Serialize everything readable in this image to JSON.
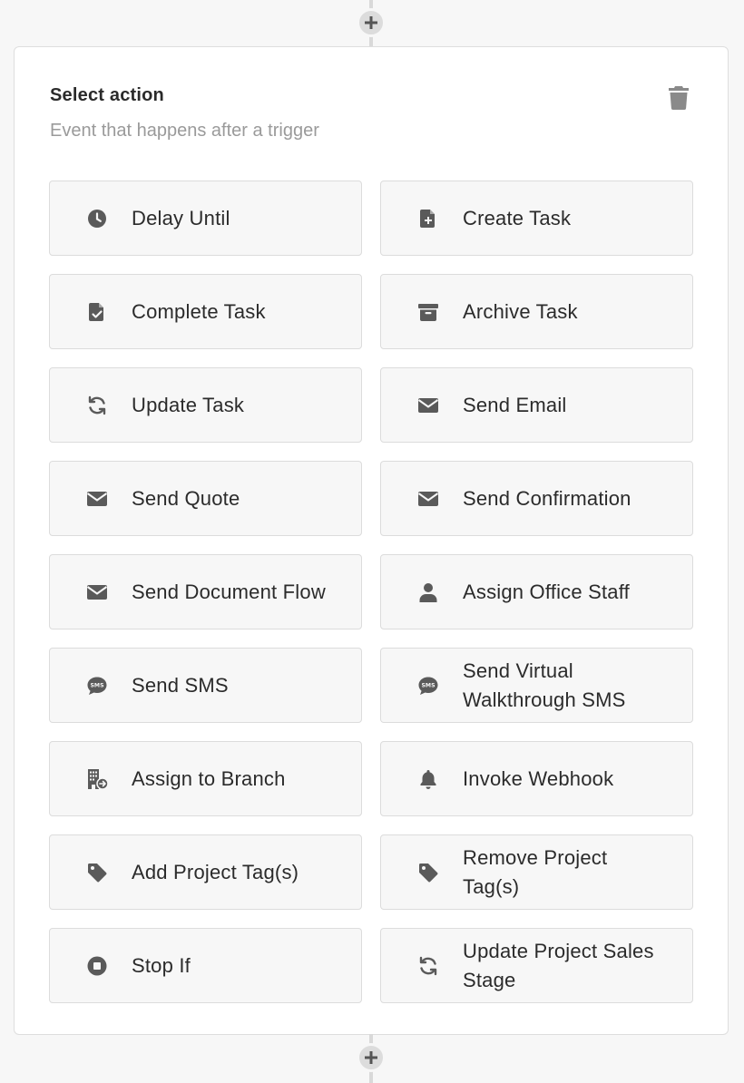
{
  "header": {
    "title": "Select action",
    "subtitle": "Event that happens after a trigger"
  },
  "colors": {
    "icon": "#5a5a5a",
    "tile_bg": "#f7f7f7",
    "tile_border": "#dcdcdc",
    "subtitle": "#9a9a9a"
  },
  "actions": [
    {
      "label": "Delay Until",
      "icon": "clock-icon"
    },
    {
      "label": "Create Task",
      "icon": "file-plus-icon"
    },
    {
      "label": "Complete Task",
      "icon": "file-check-icon"
    },
    {
      "label": "Archive Task",
      "icon": "archive-icon"
    },
    {
      "label": "Update Task",
      "icon": "refresh-icon"
    },
    {
      "label": "Send Email",
      "icon": "envelope-icon"
    },
    {
      "label": "Send Quote",
      "icon": "envelope-icon"
    },
    {
      "label": "Send Confirmation",
      "icon": "envelope-icon"
    },
    {
      "label": "Send Document Flow",
      "icon": "envelope-icon"
    },
    {
      "label": "Assign Office Staff",
      "icon": "user-icon"
    },
    {
      "label": "Send SMS",
      "icon": "sms-icon"
    },
    {
      "label": "Send Virtual Walkthrough SMS",
      "icon": "sms-icon"
    },
    {
      "label": "Assign to Branch",
      "icon": "building-arrow-icon"
    },
    {
      "label": "Invoke Webhook",
      "icon": "bell-icon"
    },
    {
      "label": "Add Project Tag(s)",
      "icon": "tag-icon"
    },
    {
      "label": "Remove Project Tag(s)",
      "icon": "tag-icon"
    },
    {
      "label": "Stop If",
      "icon": "stop-circle-icon"
    },
    {
      "label": "Update Project Sales Stage",
      "icon": "refresh-icon"
    }
  ]
}
